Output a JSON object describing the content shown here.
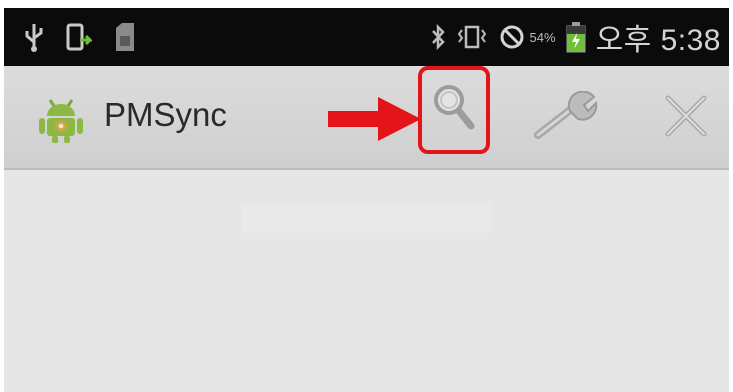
{
  "status_bar": {
    "left_icons": [
      "usb-icon",
      "screen-rotate-icon",
      "sd-card-icon"
    ],
    "right_icons": [
      "bluetooth-icon",
      "vibrate-icon",
      "no-signal-icon",
      "battery-icon"
    ],
    "battery_percent": "54%",
    "time": "오후 5:38"
  },
  "action_bar": {
    "app_name": "PMSync",
    "actions": [
      "search-icon",
      "wrench-icon",
      "close-icon"
    ]
  },
  "annotation": {
    "arrow_color": "#e4141b",
    "highlight_color": "#e4141b"
  }
}
